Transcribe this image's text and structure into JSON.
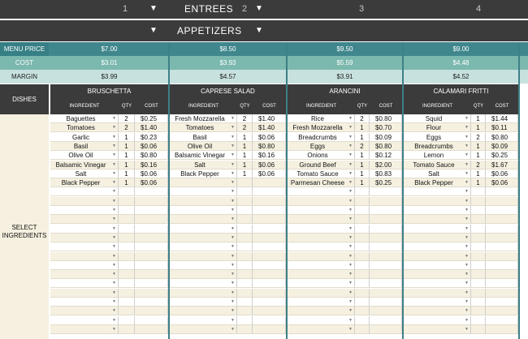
{
  "entrees": {
    "title": "ENTREES",
    "numbers": [
      "1",
      "2",
      "3",
      "4"
    ]
  },
  "appetizers": {
    "title": "APPETIZERS"
  },
  "labels": {
    "menu_price": "MENU PRICE",
    "cost": "COST",
    "margin": "MARGIN",
    "dishes": "DISHES",
    "select_ingredients": "SELECT INGREDIENTS"
  },
  "col_headers": {
    "ingredient": "INGREDIENT",
    "qty": "QTY",
    "cost": "COST"
  },
  "colors": {
    "header_dark": "#3b3b3b",
    "price_band": "#3f878d",
    "cost_band": "#7bb8ad",
    "margin_band": "#c7e1df",
    "row_alt": "#f5f0df"
  },
  "dishes": [
    {
      "name": "BRUSCHETTA",
      "price": "$7.00",
      "cost": "$3.01",
      "margin": "$3.99",
      "ingredients": [
        {
          "name": "Baguettes",
          "qty": "2",
          "cost": "$0.25"
        },
        {
          "name": "Tomatoes",
          "qty": "2",
          "cost": "$1.40"
        },
        {
          "name": "Garlic",
          "qty": "1",
          "cost": "$0.23"
        },
        {
          "name": "Basil",
          "qty": "1",
          "cost": "$0.06"
        },
        {
          "name": "Olive Oil",
          "qty": "1",
          "cost": "$0.80"
        },
        {
          "name": "Balsamic Vinegar",
          "qty": "1",
          "cost": "$0.16"
        },
        {
          "name": "Salt",
          "qty": "1",
          "cost": "$0.06"
        },
        {
          "name": "Black Pepper",
          "qty": "1",
          "cost": "$0.06"
        }
      ]
    },
    {
      "name": "CAPRESE SALAD",
      "price": "$8.50",
      "cost": "$3.93",
      "margin": "$4.57",
      "ingredients": [
        {
          "name": "Fresh Mozzarella",
          "qty": "2",
          "cost": "$1.40"
        },
        {
          "name": "Tomatoes",
          "qty": "2",
          "cost": "$1.40"
        },
        {
          "name": "Basil",
          "qty": "1",
          "cost": "$0.06"
        },
        {
          "name": "Olive Oil",
          "qty": "1",
          "cost": "$0.80"
        },
        {
          "name": "Balsamic Vinegar",
          "qty": "1",
          "cost": "$0.16"
        },
        {
          "name": "Salt",
          "qty": "1",
          "cost": "$0.06"
        },
        {
          "name": "Black Pepper",
          "qty": "1",
          "cost": "$0.06"
        }
      ]
    },
    {
      "name": "ARANCINI",
      "price": "$9.50",
      "cost": "$5.59",
      "margin": "$3.91",
      "ingredients": [
        {
          "name": "Rice",
          "qty": "2",
          "cost": "$0.80"
        },
        {
          "name": "Fresh Mozzarella",
          "qty": "1",
          "cost": "$0.70"
        },
        {
          "name": "Breadcrumbs",
          "qty": "1",
          "cost": "$0.09"
        },
        {
          "name": "Eggs",
          "qty": "2",
          "cost": "$0.80"
        },
        {
          "name": "Onions",
          "qty": "1",
          "cost": "$0.12"
        },
        {
          "name": "Ground Beef",
          "qty": "1",
          "cost": "$2.00"
        },
        {
          "name": "Tomato Sauce",
          "qty": "1",
          "cost": "$0.83"
        },
        {
          "name": "Parmesan Cheese",
          "qty": "1",
          "cost": "$0.25"
        }
      ]
    },
    {
      "name": "CALAMARI FRITTI",
      "price": "$9.00",
      "cost": "$4.48",
      "margin": "$4.52",
      "ingredients": [
        {
          "name": "Squid",
          "qty": "1",
          "cost": "$1.44"
        },
        {
          "name": "Flour",
          "qty": "1",
          "cost": "$0.11"
        },
        {
          "name": "Eggs",
          "qty": "2",
          "cost": "$0.80"
        },
        {
          "name": "Breadcrumbs",
          "qty": "1",
          "cost": "$0.09"
        },
        {
          "name": "Lemon",
          "qty": "1",
          "cost": "$0.25"
        },
        {
          "name": "Tomato Sauce",
          "qty": "2",
          "cost": "$1.67"
        },
        {
          "name": "Salt",
          "qty": "1",
          "cost": "$0.06"
        },
        {
          "name": "Black Pepper",
          "qty": "1",
          "cost": "$0.06"
        }
      ]
    }
  ]
}
